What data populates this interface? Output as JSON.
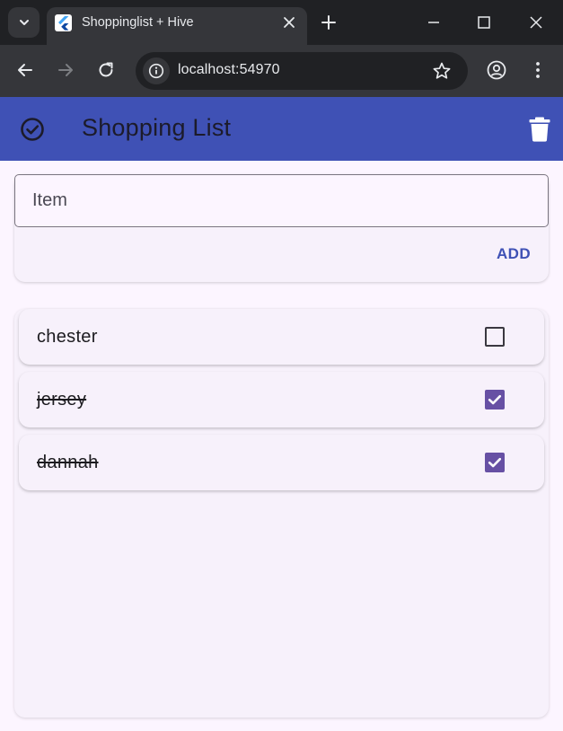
{
  "browser": {
    "tab_title": "Shoppinglist + Hive",
    "url": "localhost:54970"
  },
  "app": {
    "title": "Shopping List",
    "input": {
      "placeholder": "Item",
      "value": ""
    },
    "add_label": "ADD",
    "items": [
      {
        "label": "chester",
        "checked": false
      },
      {
        "label": "jersey",
        "checked": true
      },
      {
        "label": "dannah",
        "checked": true
      }
    ]
  },
  "colors": {
    "appbar": "#3f51b5",
    "accent": "#3f51b5",
    "checkbox_checked": "#6750a4",
    "background": "#fcf5ff",
    "card": "#f7f1fb"
  },
  "icons": {
    "appbar_leading": "check-circle-icon",
    "appbar_action": "delete-icon"
  }
}
